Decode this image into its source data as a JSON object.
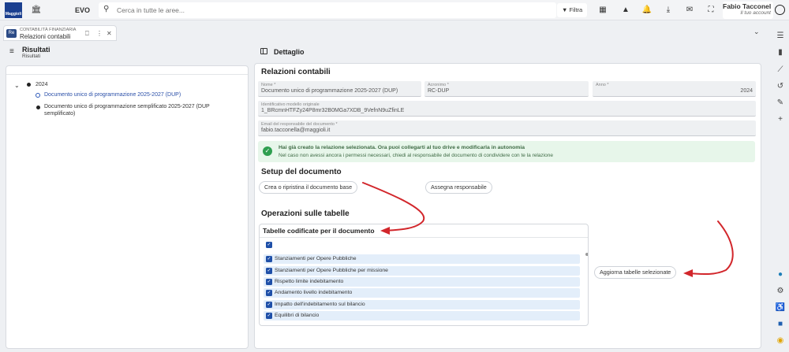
{
  "header": {
    "logo_text": "Maggioli",
    "app_name": "EVO",
    "search_placeholder": "Cerca in tutte le aree...",
    "filter_label": "Filtra",
    "user_name": "Fabio Tacconelli",
    "user_subtitle": "Il tuo account"
  },
  "tab": {
    "badge": "Re",
    "category": "CONTABILITÀ FINANZIARIA",
    "title": "Relazioni contabili"
  },
  "left": {
    "title": "Risultati",
    "subtitle": "Risultati",
    "tree": {
      "year": "2024",
      "items": [
        "Documento unico di programmazione 2025-2027 (DUP)",
        "Documento unico di programmazione semplificato 2025-2027 (DUP semplificato)"
      ]
    }
  },
  "detail": {
    "header_title": "Dettaglio",
    "section_title": "Relazioni contabili",
    "fields": {
      "nome_label": "Nome *",
      "nome_value": "Documento unico di programmazione 2025-2027 (DUP)",
      "acronimo_label": "Acronimo *",
      "acronimo_value": "RC-DUP",
      "anno_label": "Anno *",
      "anno_value": "2024",
      "id_label": "Identificativo modello originale",
      "id_value": "1_BRcmnHTFZy24P8mr32B0MGa7XDB_9VefnN9uZfinLE",
      "email_label": "Email del responsabile del documento *",
      "email_value": "fabio.tacconella@maggioli.it"
    },
    "alert": {
      "main": "Hai già creato la relazione selezionata. Ora puoi collegarti al tuo drive e modificarla in autonomia",
      "sub": "Nel caso non avessi ancora i permessi necessari, chiedi al responsabile del documento di condividere con te la relazione"
    },
    "setup": {
      "title": "Setup del documento",
      "btn_create": "Crea o ripristina il documento base",
      "btn_assign": "Assegna responsabile"
    },
    "operations": {
      "title": "Operazioni sulle tabelle",
      "box_title": "Tabelle codificate per il documento",
      "rows": [
        "Stanziamenti per Opere Pubbliche",
        "Stanziamenti per Opere Pubbliche per missione",
        "Rispetto limite indebitamento",
        "Andamento livello indebitamento",
        "Impatto dell'indebitamento sul bilancio",
        "Equilibri di bilancio"
      ],
      "update_btn": "Aggiorna tabelle selezionate"
    }
  },
  "colors": {
    "accent": "#1e4fa8",
    "annotation": "#d2262b",
    "success": "#2e9e4f"
  }
}
